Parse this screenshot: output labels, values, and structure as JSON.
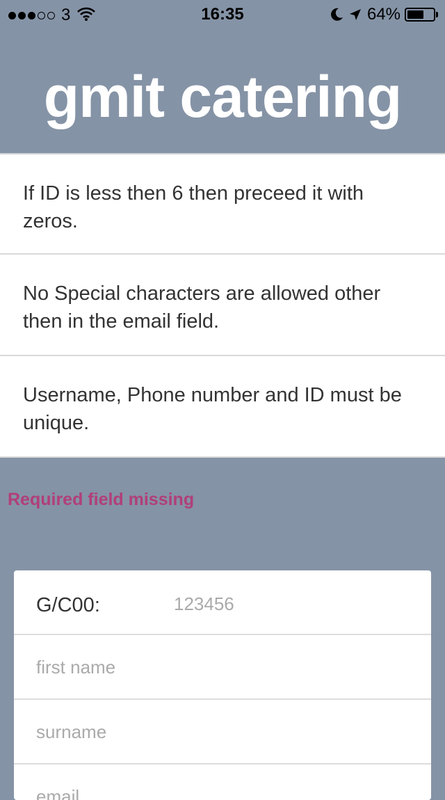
{
  "status_bar": {
    "signal_filled": 3,
    "signal_total": 5,
    "carrier": "3",
    "time": "16:35",
    "battery_percent": "64%",
    "battery_level": 0.64,
    "icons": [
      "wifi-icon",
      "moon-icon",
      "location-arrow-icon",
      "battery-icon"
    ]
  },
  "header": {
    "title": "gmit catering"
  },
  "rules": [
    {
      "text": "If ID is less then 6 then preceed it with zeros."
    },
    {
      "text": "No Special characters are allowed other then in the email field."
    },
    {
      "text": "Username, Phone number and ID must be unique."
    }
  ],
  "error": {
    "message": "Required field missing"
  },
  "form": {
    "id_label": "G/C00:",
    "id_placeholder": "123456",
    "first_name_placeholder": "first name",
    "surname_placeholder": "surname",
    "email_placeholder": "email"
  },
  "colors": {
    "background": "#8593a6",
    "error": "#b03f7a",
    "card": "#ffffff"
  }
}
